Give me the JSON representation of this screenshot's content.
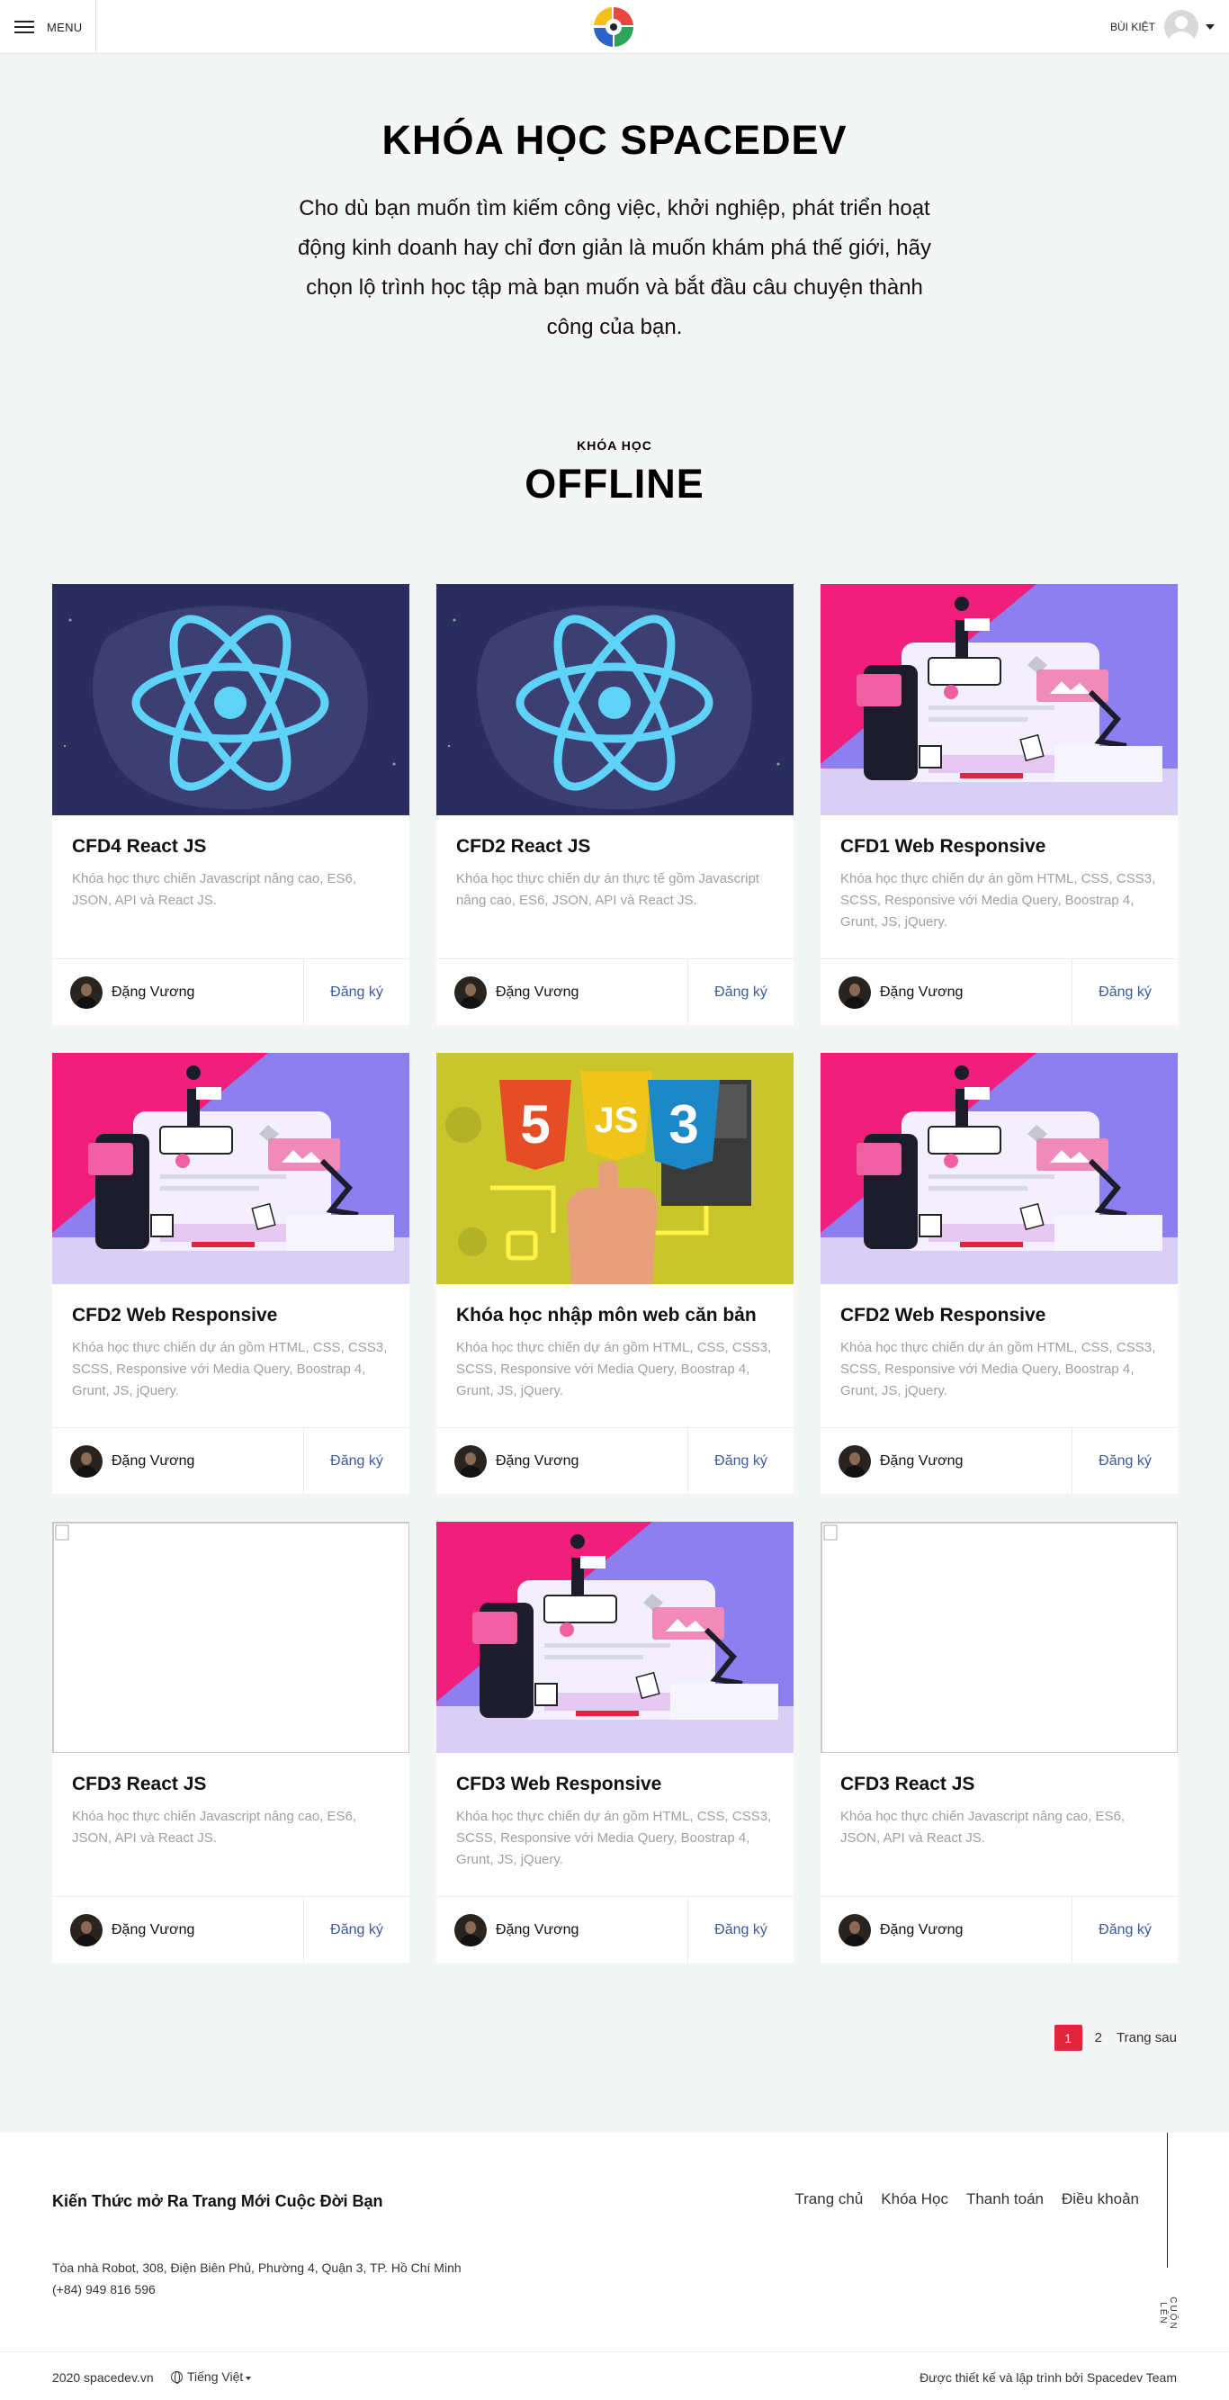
{
  "header": {
    "menu_label": "MENU",
    "user_name": "BÙI KIỆT"
  },
  "hero": {
    "title": "KHÓA HỌC SPACEDEV",
    "description": "Cho dù bạn muốn tìm kiếm công việc, khởi nghiệp, phát triển hoạt động kinh doanh hay chỉ đơn giản là muốn khám phá thế giới, hãy chọn lộ trình học tập mà bạn muốn và bắt đầu câu chuyện thành công của bạn."
  },
  "section": {
    "kicker": "KHÓA HỌC",
    "title": "OFFLINE"
  },
  "courses": [
    {
      "title": "CFD4 React JS",
      "desc": "Khóa học thực chiến Javascript nâng cao, ES6, JSON, API và React JS.",
      "teacher": "Đặng Vương",
      "action": "Đăng ký",
      "image": "react-image"
    },
    {
      "title": "CFD2 React JS",
      "desc": "Khóa học thực chiến dự án thực tế gồm Javascript nâng cao, ES6, JSON, API và React JS.",
      "teacher": "Đặng Vương",
      "action": "Đăng ký",
      "image": "react-image"
    },
    {
      "title": "CFD1 Web Responsive",
      "desc": "Khóa học thực chiến dự án gồm HTML, CSS, CSS3, SCSS, Responsive với Media Query, Boostrap 4, Grunt, JS, jQuery.",
      "teacher": "Đặng Vương",
      "action": "Đăng ký",
      "image": "responsive-illustration"
    },
    {
      "title": "CFD2 Web Responsive",
      "desc": "Khóa học thực chiến dự án gồm HTML, CSS, CSS3, SCSS, Responsive với Media Query, Boostrap 4, Grunt, JS, jQuery.",
      "teacher": "Đặng Vương",
      "action": "Đăng ký",
      "image": "responsive-illustration"
    },
    {
      "title": "Khóa học nhập môn web căn bản",
      "desc": "Khóa học thực chiến dự án gồm HTML, CSS, CSS3, SCSS, Responsive với Media Query, Boostrap 4, Grunt, JS, jQuery.",
      "teacher": "Đặng Vương",
      "action": "Đăng ký",
      "image": "html-js-css-image"
    },
    {
      "title": "CFD2 Web Responsive",
      "desc": "Khóa học thực chiến dự án gồm HTML, CSS, CSS3, SCSS, Responsive với Media Query, Boostrap 4, Grunt, JS, jQuery.",
      "teacher": "Đặng Vương",
      "action": "Đăng ký",
      "image": "responsive-illustration"
    },
    {
      "title": "CFD3 React JS",
      "desc": "Khóa học thực chiến Javascript nâng cao, ES6, JSON, API và React JS.",
      "teacher": "Đặng Vương",
      "action": "Đăng ký",
      "image": "broken-image"
    },
    {
      "title": "CFD3 Web Responsive",
      "desc": "Khóa học thực chiến dự án gồm HTML, CSS, CSS3, SCSS, Responsive với Media Query, Boostrap 4, Grunt, JS, jQuery.",
      "teacher": "Đặng Vương",
      "action": "Đăng ký",
      "image": "responsive-illustration"
    },
    {
      "title": "CFD3 React JS",
      "desc": "Khóa học thực chiến Javascript nâng cao, ES6, JSON, API và React JS.",
      "teacher": "Đặng Vương",
      "action": "Đăng ký",
      "image": "broken-image"
    }
  ],
  "pagination": {
    "current": "1",
    "page2": "2",
    "next": "Trang sau",
    "active_color": "#e0263e"
  },
  "footer": {
    "tagline": "Kiến Thức mở Ra Trang Mới Cuộc Đời Bạn",
    "nav": [
      "Trang chủ",
      "Khóa Học",
      "Thanh toán",
      "Điều khoản"
    ],
    "address": "Tòa nhà Robot, 308, Điện Biên Phủ, Phường 4, Quận 3, TP. Hồ Chí Minh",
    "phone": "(+84) 949 816 596",
    "scroll_top": "CUỘN LÊN",
    "copyright": "2020 spacedev.vn",
    "language": "Tiếng Việt",
    "credit": "Được thiết kế và lập trình bởi Spacedev Team"
  },
  "colors": {
    "link": "#3c5a9a",
    "background": "#f4f5f5"
  }
}
